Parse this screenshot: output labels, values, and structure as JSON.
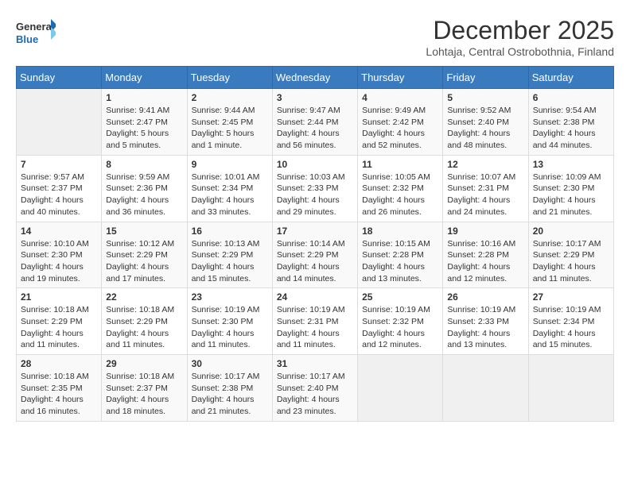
{
  "logo": {
    "line1": "General",
    "line2": "Blue"
  },
  "title": "December 2025",
  "subtitle": "Lohtaja, Central Ostrobothnia, Finland",
  "days_header": [
    "Sunday",
    "Monday",
    "Tuesday",
    "Wednesday",
    "Thursday",
    "Friday",
    "Saturday"
  ],
  "weeks": [
    [
      {
        "day": "",
        "info": ""
      },
      {
        "day": "1",
        "info": "Sunrise: 9:41 AM\nSunset: 2:47 PM\nDaylight: 5 hours\nand 5 minutes."
      },
      {
        "day": "2",
        "info": "Sunrise: 9:44 AM\nSunset: 2:45 PM\nDaylight: 5 hours\nand 1 minute."
      },
      {
        "day": "3",
        "info": "Sunrise: 9:47 AM\nSunset: 2:44 PM\nDaylight: 4 hours\nand 56 minutes."
      },
      {
        "day": "4",
        "info": "Sunrise: 9:49 AM\nSunset: 2:42 PM\nDaylight: 4 hours\nand 52 minutes."
      },
      {
        "day": "5",
        "info": "Sunrise: 9:52 AM\nSunset: 2:40 PM\nDaylight: 4 hours\nand 48 minutes."
      },
      {
        "day": "6",
        "info": "Sunrise: 9:54 AM\nSunset: 2:38 PM\nDaylight: 4 hours\nand 44 minutes."
      }
    ],
    [
      {
        "day": "7",
        "info": "Sunrise: 9:57 AM\nSunset: 2:37 PM\nDaylight: 4 hours\nand 40 minutes."
      },
      {
        "day": "8",
        "info": "Sunrise: 9:59 AM\nSunset: 2:36 PM\nDaylight: 4 hours\nand 36 minutes."
      },
      {
        "day": "9",
        "info": "Sunrise: 10:01 AM\nSunset: 2:34 PM\nDaylight: 4 hours\nand 33 minutes."
      },
      {
        "day": "10",
        "info": "Sunrise: 10:03 AM\nSunset: 2:33 PM\nDaylight: 4 hours\nand 29 minutes."
      },
      {
        "day": "11",
        "info": "Sunrise: 10:05 AM\nSunset: 2:32 PM\nDaylight: 4 hours\nand 26 minutes."
      },
      {
        "day": "12",
        "info": "Sunrise: 10:07 AM\nSunset: 2:31 PM\nDaylight: 4 hours\nand 24 minutes."
      },
      {
        "day": "13",
        "info": "Sunrise: 10:09 AM\nSunset: 2:30 PM\nDaylight: 4 hours\nand 21 minutes."
      }
    ],
    [
      {
        "day": "14",
        "info": "Sunrise: 10:10 AM\nSunset: 2:30 PM\nDaylight: 4 hours\nand 19 minutes."
      },
      {
        "day": "15",
        "info": "Sunrise: 10:12 AM\nSunset: 2:29 PM\nDaylight: 4 hours\nand 17 minutes."
      },
      {
        "day": "16",
        "info": "Sunrise: 10:13 AM\nSunset: 2:29 PM\nDaylight: 4 hours\nand 15 minutes."
      },
      {
        "day": "17",
        "info": "Sunrise: 10:14 AM\nSunset: 2:29 PM\nDaylight: 4 hours\nand 14 minutes."
      },
      {
        "day": "18",
        "info": "Sunrise: 10:15 AM\nSunset: 2:28 PM\nDaylight: 4 hours\nand 13 minutes."
      },
      {
        "day": "19",
        "info": "Sunrise: 10:16 AM\nSunset: 2:28 PM\nDaylight: 4 hours\nand 12 minutes."
      },
      {
        "day": "20",
        "info": "Sunrise: 10:17 AM\nSunset: 2:29 PM\nDaylight: 4 hours\nand 11 minutes."
      }
    ],
    [
      {
        "day": "21",
        "info": "Sunrise: 10:18 AM\nSunset: 2:29 PM\nDaylight: 4 hours\nand 11 minutes."
      },
      {
        "day": "22",
        "info": "Sunrise: 10:18 AM\nSunset: 2:29 PM\nDaylight: 4 hours\nand 11 minutes."
      },
      {
        "day": "23",
        "info": "Sunrise: 10:19 AM\nSunset: 2:30 PM\nDaylight: 4 hours\nand 11 minutes."
      },
      {
        "day": "24",
        "info": "Sunrise: 10:19 AM\nSunset: 2:31 PM\nDaylight: 4 hours\nand 11 minutes."
      },
      {
        "day": "25",
        "info": "Sunrise: 10:19 AM\nSunset: 2:32 PM\nDaylight: 4 hours\nand 12 minutes."
      },
      {
        "day": "26",
        "info": "Sunrise: 10:19 AM\nSunset: 2:33 PM\nDaylight: 4 hours\nand 13 minutes."
      },
      {
        "day": "27",
        "info": "Sunrise: 10:19 AM\nSunset: 2:34 PM\nDaylight: 4 hours\nand 15 minutes."
      }
    ],
    [
      {
        "day": "28",
        "info": "Sunrise: 10:18 AM\nSunset: 2:35 PM\nDaylight: 4 hours\nand 16 minutes."
      },
      {
        "day": "29",
        "info": "Sunrise: 10:18 AM\nSunset: 2:37 PM\nDaylight: 4 hours\nand 18 minutes."
      },
      {
        "day": "30",
        "info": "Sunrise: 10:17 AM\nSunset: 2:38 PM\nDaylight: 4 hours\nand 21 minutes."
      },
      {
        "day": "31",
        "info": "Sunrise: 10:17 AM\nSunset: 2:40 PM\nDaylight: 4 hours\nand 23 minutes."
      },
      {
        "day": "",
        "info": ""
      },
      {
        "day": "",
        "info": ""
      },
      {
        "day": "",
        "info": ""
      }
    ]
  ]
}
